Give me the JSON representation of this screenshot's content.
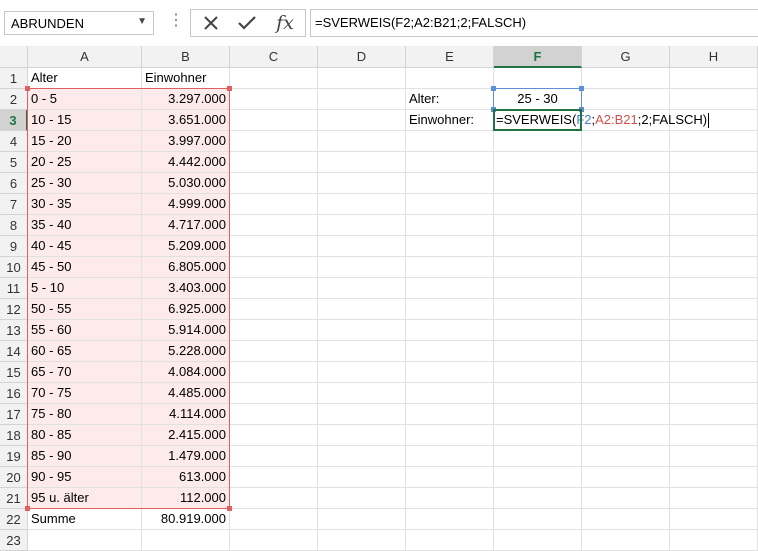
{
  "name_box": {
    "value": "ABRUNDEN"
  },
  "formula_bar": {
    "cancel_icon": "cross-icon",
    "enter_icon": "check-icon",
    "function_icon": "fx-icon",
    "value": "=SVERWEIS(F2;A2:B21;2;FALSCH)"
  },
  "columns": [
    "A",
    "B",
    "C",
    "D",
    "E",
    "F",
    "G",
    "H"
  ],
  "rows": [
    "1",
    "2",
    "3",
    "4",
    "5",
    "6",
    "7",
    "8",
    "9",
    "10",
    "11",
    "12",
    "13",
    "14",
    "15",
    "16",
    "17",
    "18",
    "19",
    "20",
    "21",
    "22",
    "23"
  ],
  "table": {
    "header_alter": "Alter",
    "header_einwohner": "Einwohner",
    "data": [
      [
        "0 - 5",
        "3.297.000"
      ],
      [
        "10 - 15",
        "3.651.000"
      ],
      [
        "15 - 20",
        "3.997.000"
      ],
      [
        "20 - 25",
        "4.442.000"
      ],
      [
        "25 - 30",
        "5.030.000"
      ],
      [
        "30 - 35",
        "4.999.000"
      ],
      [
        "35 - 40",
        "4.717.000"
      ],
      [
        "40 - 45",
        "5.209.000"
      ],
      [
        "45 - 50",
        "6.805.000"
      ],
      [
        "5 - 10",
        "3.403.000"
      ],
      [
        "50 - 55",
        "6.925.000"
      ],
      [
        "55 - 60",
        "5.914.000"
      ],
      [
        "60 - 65",
        "5.228.000"
      ],
      [
        "65 - 70",
        "4.084.000"
      ],
      [
        "70 - 75",
        "4.485.000"
      ],
      [
        "75 - 80",
        "4.114.000"
      ],
      [
        "80 - 85",
        "2.415.000"
      ],
      [
        "85 - 90",
        "1.479.000"
      ],
      [
        "90 - 95",
        "613.000"
      ],
      [
        "95 u. älter",
        "112.000"
      ]
    ],
    "sum_label": "Summe",
    "sum_value": "80.919.000"
  },
  "lookup": {
    "label_alter": "Alter:",
    "value_alter": "25 - 30",
    "label_einwohner": "Einwohner:",
    "edit_prefix": "=SVERWEIS(",
    "edit_ref1": "F2",
    "edit_sep": ";",
    "edit_ref2": "A2:B21",
    "edit_suffix": ";2;FALSCH)"
  },
  "colors": {
    "accent": "#217346",
    "range_red": "#e06060",
    "range_blue": "#5b8fd6",
    "tint": "#fdeaea"
  }
}
